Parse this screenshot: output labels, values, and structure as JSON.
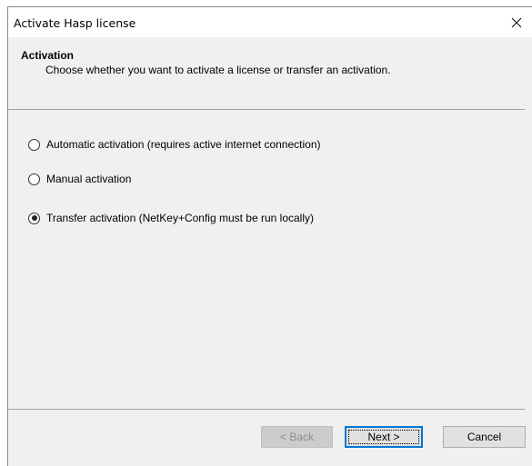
{
  "window": {
    "title": "Activate Hasp license",
    "close_icon": "close-icon"
  },
  "header": {
    "title": "Activation",
    "description": "Choose whether you want to activate a license or transfer an activation."
  },
  "options": [
    {
      "label": "Automatic activation (requires active internet connection)",
      "checked": false
    },
    {
      "label": "Manual activation",
      "checked": false
    },
    {
      "label": "Transfer activation (NetKey+Config must be run locally)",
      "checked": true
    }
  ],
  "buttons": {
    "back": "< Back",
    "next": "Next >",
    "cancel": "Cancel"
  }
}
